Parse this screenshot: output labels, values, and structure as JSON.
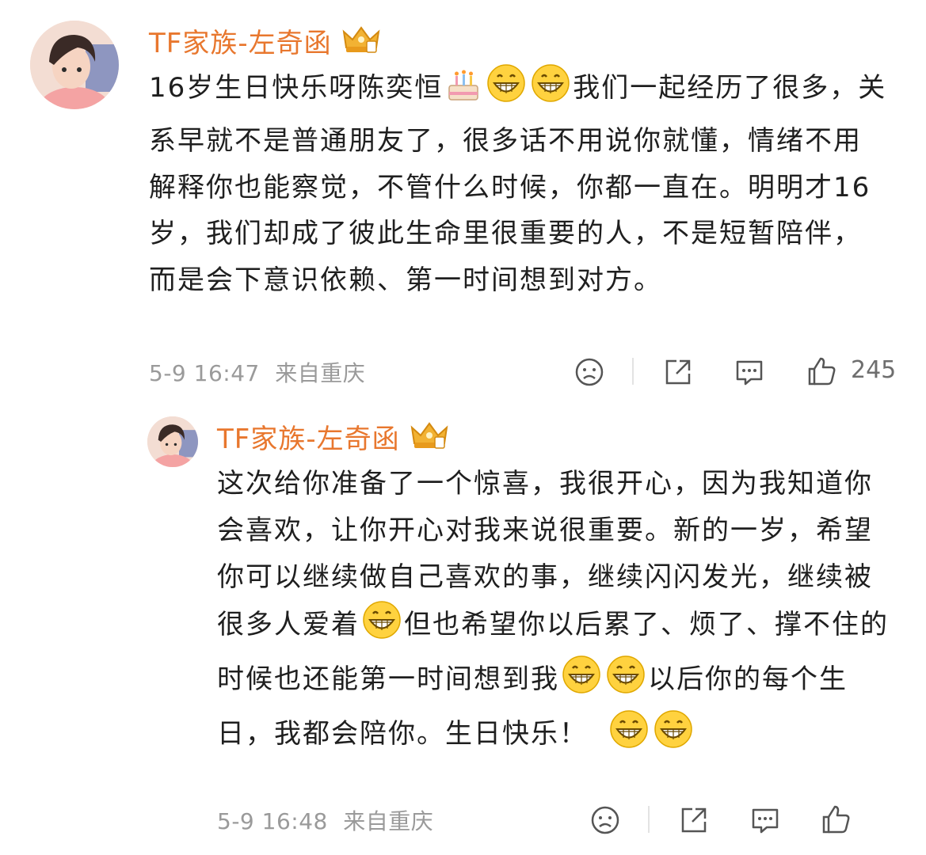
{
  "comment": {
    "username": "TF家族-左奇函",
    "content_1": "16岁生日快乐呀陈奕恒",
    "content_2": "我们一起经历了很多，关系早就不是普通朋友了，很多话不用说你就懂，情绪不用解释你也能察觉，不管什么时候，你都一直在。明明才16岁，我们却成了彼此生命里很重要的人，不是短暂陪伴，而是会下意识依赖、第一时间想到对方。",
    "timestamp": "5-9 16:47",
    "location": "来自重庆",
    "like_count": "245"
  },
  "reply": {
    "username": "TF家族-左奇函",
    "content_1": "这次给你准备了一个惊喜，我很开心，因为我知道你会喜欢，让你开心对我来说很重要。新的一岁，希望你可以继续做自己喜欢的事，继续闪闪发光，继续被很多人爱着",
    "content_2": "但也希望你以后累了、烦了、撑不住的时候也还能第一时间想到我",
    "content_3": "以后你的每个生日，我都会陪你。生日快乐！",
    "timestamp": "5-9 16:48",
    "location": "来自重庆"
  },
  "colors": {
    "username": "#e8772e",
    "text": "#1f1f1f",
    "meta": "#9a9a9a",
    "icon": "#555555"
  },
  "icons": [
    "cake-emoji",
    "grin-emoji",
    "crown-badge-icon",
    "dislike-face-icon",
    "share-icon",
    "comment-icon",
    "like-icon"
  ]
}
